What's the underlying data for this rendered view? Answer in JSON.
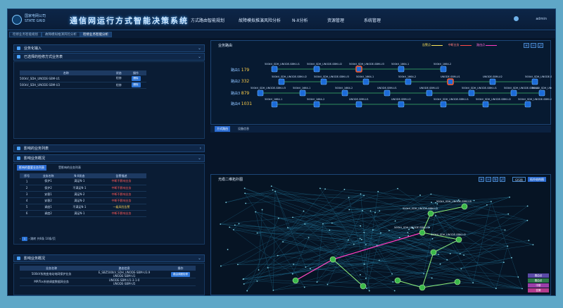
{
  "header": {
    "logo_line1": "国家电网公司",
    "logo_line2": "STATE GRID",
    "app_title": "通信网运行方式智能决策系统",
    "nav": [
      "方式路由智能规划",
      "故障模拟推演风险分析",
      "N-X分析",
      "资源管理",
      "系统管理"
    ],
    "user": "admin"
  },
  "tabs": [
    "检修业务智能规划",
    "故障模拟推演风险分析",
    "检修业务智能分析"
  ],
  "left": {
    "section1": "业务化输入",
    "section2": "已选择的检修方式业务表",
    "table1": {
      "headers": [
        "名称",
        "状态",
        "操作"
      ],
      "rows": [
        {
          "name": "500kV_SDH_UNODE-SBM-U1",
          "status": "检修",
          "op": "删除"
        },
        {
          "name": "500kV_SDH_UNODE-SBM-U3",
          "status": "检修",
          "op": "删除"
        }
      ]
    },
    "section3": "影响的业务列表",
    "section4": "影响业务概况",
    "subtabs": [
      "影响的重要业务列表",
      "受影响的业务列表"
    ],
    "table2": {
      "headers": [
        "序号",
        "业务名称",
        "N-X状态",
        "告警描述"
      ],
      "rows": [
        {
          "no": "1",
          "name": "保护1",
          "state": "满足N-1",
          "desc": "中断不影响业务",
          "cls": "red"
        },
        {
          "no": "2",
          "name": "保护2",
          "state": "不满足N-1",
          "desc": "中断不影响业务",
          "cls": "red"
        },
        {
          "no": "3",
          "name": "安稳1",
          "state": "满足N-2",
          "desc": "中断不影响业务",
          "cls": "red"
        },
        {
          "no": "4",
          "name": "安稳2",
          "state": "满足N-2",
          "desc": "中断不影响业务",
          "cls": "red"
        },
        {
          "no": "5",
          "name": "调度1",
          "state": "不满足N-1",
          "desc": "一级风险告警",
          "cls": "yel"
        },
        {
          "no": "6",
          "name": "调度2",
          "state": "满足N-1",
          "desc": "中断不影响业务",
          "cls": "red"
        }
      ]
    },
    "pager": {
      "current": "1",
      "goto": "跳转",
      "total": "共6条",
      "size": "10条/页"
    },
    "section5": "影响业务概况",
    "table3": {
      "headers": [
        "业务名称",
        "路由信息",
        "操作"
      ],
      "rows": [
        {
          "name": "500kV系统变电站电网保护业务",
          "route": "E_SBZ500kV_SDH_UNODE-SBM-U3.9",
          "route2": "UNODE-SBM-U1",
          "op": "路由调度检修"
        },
        {
          "name": "MP/Tos系统调度数据网业务",
          "route": "UNODE-SBM-U1-3-1-0",
          "route2": "UNODE-SBM-U5",
          "op": ""
        }
      ]
    }
  },
  "right": {
    "pane1_title": "业务路由",
    "legend": [
      "告警点",
      "中断业务",
      "路由点"
    ],
    "rows": [
      {
        "label": "路由1",
        "value": "179"
      },
      {
        "label": "路由2",
        "value": "332"
      },
      {
        "label": "路由3",
        "value": "879"
      },
      {
        "label": "路由4",
        "value": "1031"
      }
    ],
    "node_labels": [
      "500kV_SDH_UNODE-SBM-U1",
      "500kV_SDH_UNODE-SBM-U2",
      "500kV_SDH_UNODE-SBM-U3",
      "500kV_1664-1",
      "500kV_1664-2",
      "UNODE-SBM-U1",
      "UNODE-SBM-U2"
    ],
    "bottom_tabs": [
      "方式路由",
      "设备信息"
    ],
    "pane2_title": "光缆二维拓扑图",
    "pane2_btns": [
      "GIS图",
      "拓扑结构图"
    ],
    "pane2_legend": [
      "路由点",
      "路由点",
      "中断",
      "告警"
    ],
    "topo_labels": [
      "500kV_SDH_UNODE-SBM-U5",
      "500kV_SDH_UNODE-SBM-U3",
      "500kV_SDH_UNODE-SBM-U1",
      "500kV_SDH_UNODE-SBM-U2"
    ]
  },
  "colors": {
    "accent": "#2c74d6",
    "alarm": "#ff4a4a",
    "route": "#39d46b",
    "interrupt": "#ff3ec1"
  }
}
